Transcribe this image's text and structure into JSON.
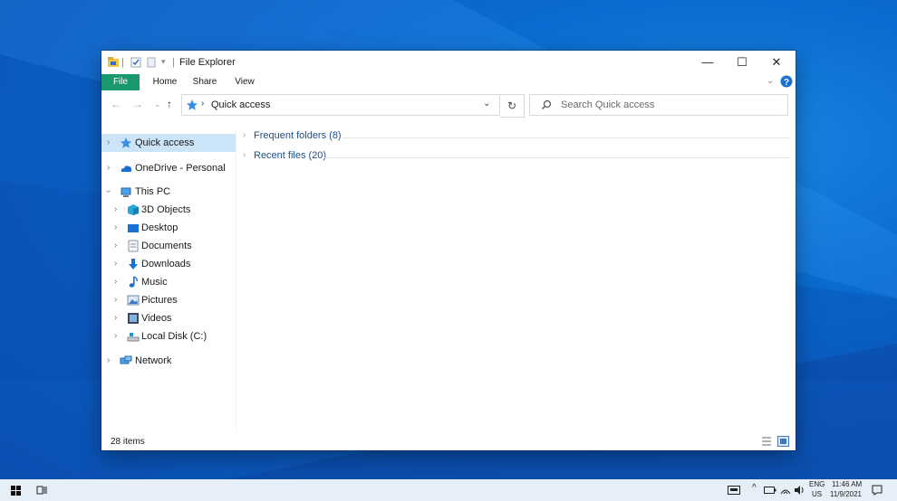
{
  "window": {
    "title": "File Explorer",
    "tabs": [
      "File",
      "Home",
      "Share",
      "View"
    ]
  },
  "address": {
    "path": "Quick access",
    "search_placeholder": "Search Quick access"
  },
  "nav_pane": {
    "items": [
      {
        "label": "Quick access",
        "icon": "star-icon"
      },
      {
        "label": "OneDrive - Personal",
        "icon": "cloud-icon"
      },
      {
        "label": "This PC",
        "icon": "computer-icon"
      },
      {
        "label": "3D Objects",
        "icon": "cube-icon"
      },
      {
        "label": "Desktop",
        "icon": "desktop-icon"
      },
      {
        "label": "Documents",
        "icon": "document-icon"
      },
      {
        "label": "Downloads",
        "icon": "download-icon"
      },
      {
        "label": "Music",
        "icon": "music-icon"
      },
      {
        "label": "Pictures",
        "icon": "pictures-icon"
      },
      {
        "label": "Videos",
        "icon": "videos-icon"
      },
      {
        "label": "Local Disk (C:)",
        "icon": "disk-icon"
      },
      {
        "label": "Network",
        "icon": "network-icon"
      }
    ]
  },
  "content": {
    "groups": [
      {
        "label": "Frequent folders (8)"
      },
      {
        "label": "Recent files (20)"
      }
    ]
  },
  "status": {
    "items_count": "28 items"
  },
  "taskbar": {
    "lang_top": "ENG",
    "lang_bottom": "US",
    "time": "11:46 AM",
    "date": "11/9/2021"
  },
  "colors": {
    "accent_green": "#1a9a6c",
    "selection": "#cce4f7",
    "desktop_blue": "#0a6cd0",
    "link_blue": "#1e4e8c"
  }
}
